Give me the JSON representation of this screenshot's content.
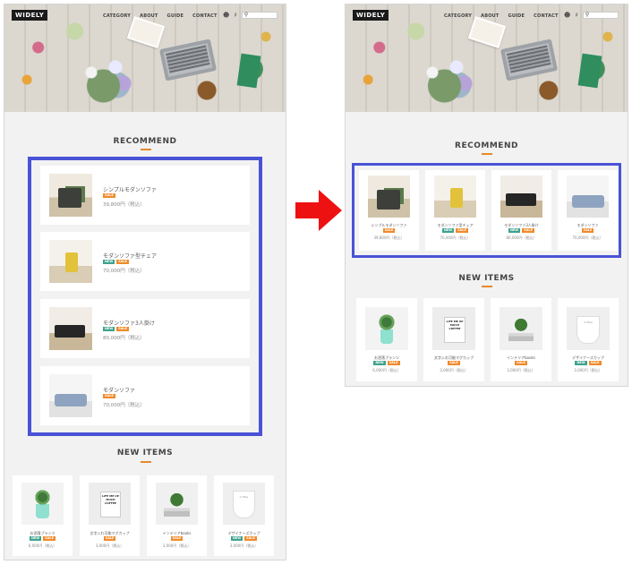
{
  "brand": {
    "logo": "WIDELY"
  },
  "nav": {
    "items": [
      "CATEGORY",
      "ABOUT",
      "GUIDE",
      "CONTACT"
    ]
  },
  "icons": {
    "user": "user-icon",
    "cart": "cart-icon",
    "search": "search-icon"
  },
  "sections": {
    "recommend": "RECOMMEND",
    "new_items": "NEW ITEMS"
  },
  "badges": {
    "new": "NEW",
    "sale": "SALE"
  },
  "recommend": [
    {
      "name": "シンプルモダンソファ",
      "badges": [
        "sale"
      ],
      "price": "39,800円（税込）",
      "image": "sofa-green"
    },
    {
      "name": "モダンソファ型チェア",
      "badges": [
        "new",
        "sale"
      ],
      "price": "70,000円（税込）",
      "image": "chair-yellow"
    },
    {
      "name": "モダンソファ3人掛け",
      "badges": [
        "new",
        "sale"
      ],
      "price": "80,000円（税込）",
      "image": "sofa-black"
    },
    {
      "name": "モダンソファ",
      "badges": [
        "sale"
      ],
      "price": "70,000円（税込）",
      "image": "sofa-blue"
    }
  ],
  "new_items": [
    {
      "name": "お洒落プランツ",
      "badges": [
        "new",
        "sale"
      ],
      "price": "6,000円（税込）",
      "image": "plant"
    },
    {
      "name": "文字入れ可能マグカップ",
      "badges": [
        "sale"
      ],
      "price": "3,000円（税込）",
      "image": "mug"
    },
    {
      "name": "インテリアbooks",
      "badges": [
        "sale"
      ],
      "price": "3,000円（税込）",
      "image": "books"
    },
    {
      "name": "デザイナーズカップ",
      "badges": [
        "new",
        "sale"
      ],
      "price": "3,000円（税込）",
      "image": "cup"
    }
  ],
  "colors": {
    "accent": "#e58a2a",
    "highlight": "#4a52d6",
    "arrow": "#ee1111",
    "new_badge": "#3fa28d",
    "sale_badge": "#f08a2a"
  }
}
